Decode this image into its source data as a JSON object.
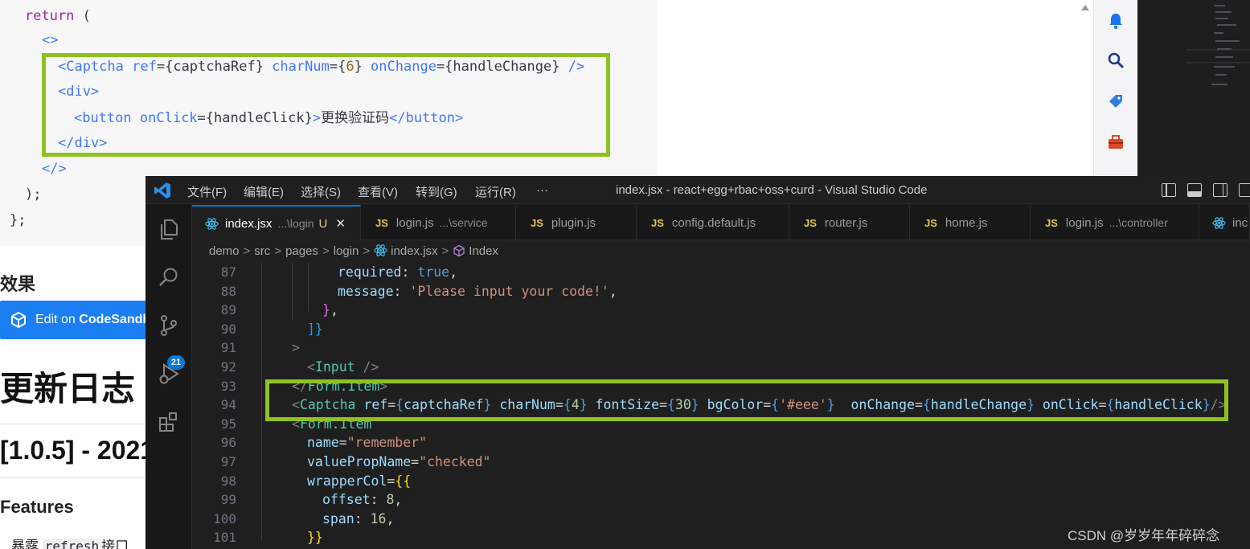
{
  "doc": {
    "code_lines": [
      {
        "tokens": [
          {
            "t": "return",
            "c": "kw"
          },
          {
            "t": " (",
            "c": "br"
          }
        ]
      },
      {
        "tokens": [
          {
            "t": "<>",
            "c": "tag"
          }
        ]
      },
      {
        "tokens": [
          {
            "t": "<Captcha",
            "c": "tag"
          },
          {
            "t": " ref",
            "c": "attr"
          },
          {
            "t": "={",
            "c": "br"
          },
          {
            "t": "captchaRef",
            "c": "id"
          },
          {
            "t": "}",
            "c": "br"
          },
          {
            "t": " charNum",
            "c": "attr"
          },
          {
            "t": "={",
            "c": "br"
          },
          {
            "t": "6",
            "c": "num"
          },
          {
            "t": "}",
            "c": "br"
          },
          {
            "t": " onChange",
            "c": "attr"
          },
          {
            "t": "={",
            "c": "br"
          },
          {
            "t": "handleChange",
            "c": "id"
          },
          {
            "t": "}",
            "c": "br"
          },
          {
            "t": " />",
            "c": "tag"
          }
        ]
      },
      {
        "tokens": [
          {
            "t": "<div>",
            "c": "tag"
          }
        ]
      },
      {
        "tokens": [
          {
            "t": "<button",
            "c": "tag"
          },
          {
            "t": " onClick",
            "c": "attr"
          },
          {
            "t": "={",
            "c": "br"
          },
          {
            "t": "handleClick",
            "c": "id"
          },
          {
            "t": "}",
            "c": "br"
          },
          {
            "t": ">",
            "c": "tag"
          },
          {
            "t": "更换验证码",
            "c": "cn"
          },
          {
            "t": "</button>",
            "c": "tag"
          }
        ]
      },
      {
        "tokens": [
          {
            "t": "</div>",
            "c": "tag"
          }
        ]
      },
      {
        "tokens": [
          {
            "t": "</>",
            "c": "tag"
          }
        ]
      },
      {
        "tokens": [
          {
            "t": ");",
            "c": "br"
          }
        ]
      },
      {
        "tokens": [
          {
            "t": "};",
            "c": "br"
          }
        ]
      }
    ],
    "effect_heading": "效果",
    "codesandbox_label_prefix": "Edit on ",
    "codesandbox_label_bold": "CodeSandb",
    "changelog_heading": "更新日志",
    "version_heading": "[1.0.5] - 2021",
    "features_heading": "Features",
    "list_item_prefix": "暴露",
    "list_item_code": "refresh",
    "list_item_suffix": "接口"
  },
  "vscode": {
    "menu": [
      "文件(F)",
      "编辑(E)",
      "选择(S)",
      "查看(V)",
      "转到(G)",
      "运行(R)",
      "···"
    ],
    "window_title": "index.jsx - react+egg+rbac+oss+curd - Visual Studio Code",
    "scm_badge": "21",
    "tabs": [
      {
        "name": "index.jsx",
        "desc": "...\\login",
        "badge": "U",
        "kind": "react",
        "active": true
      },
      {
        "name": "login.js",
        "desc": "...\\service",
        "kind": "js"
      },
      {
        "name": "plugin.js",
        "desc": "",
        "kind": "js"
      },
      {
        "name": "config.default.js",
        "desc": "",
        "kind": "js"
      },
      {
        "name": "router.js",
        "desc": "",
        "kind": "js"
      },
      {
        "name": "home.js",
        "desc": "",
        "kind": "js"
      },
      {
        "name": "login.js",
        "desc": "...\\controller",
        "kind": "js"
      },
      {
        "name": "inc",
        "desc": "",
        "kind": "react"
      }
    ],
    "breadcrumb": [
      "demo",
      "src",
      "pages",
      "login",
      "index.jsx",
      "Index"
    ],
    "line_numbers": [
      "87",
      "88",
      "89",
      "90",
      "91",
      "92",
      "93",
      "94",
      "95",
      "96",
      "97",
      "98",
      "99",
      "100",
      "101"
    ],
    "code_lines": [
      [
        {
          "t": "required",
          "c": "prop"
        },
        {
          "t": ": ",
          "c": "plain"
        },
        {
          "t": "true",
          "c": "kw"
        },
        {
          "t": ",",
          "c": "plain"
        }
      ],
      [
        {
          "t": "message",
          "c": "prop"
        },
        {
          "t": ": ",
          "c": "plain"
        },
        {
          "t": "'Please input your code!'",
          "c": "str"
        },
        {
          "t": ",",
          "c": "plain"
        }
      ],
      [
        {
          "t": "}",
          "c": "br2"
        },
        {
          "t": ",",
          "c": "plain"
        }
      ],
      [
        {
          "t": "]}",
          "c": "br3"
        }
      ],
      [
        {
          "t": ">",
          "c": "ang"
        }
      ],
      [
        {
          "t": "<",
          "c": "ang"
        },
        {
          "t": "Input",
          "c": "tag"
        },
        {
          "t": " />",
          "c": "ang"
        }
      ],
      [
        {
          "t": "</",
          "c": "ang"
        },
        {
          "t": "Form.Item",
          "c": "tag"
        },
        {
          "t": ">",
          "c": "ang"
        }
      ],
      [
        {
          "t": "<",
          "c": "ang"
        },
        {
          "t": "Captcha",
          "c": "tag"
        },
        {
          "t": " ref",
          "c": "prop"
        },
        {
          "t": "=",
          "c": "plain"
        },
        {
          "t": "{",
          "c": "kw"
        },
        {
          "t": "captchaRef",
          "c": "prop"
        },
        {
          "t": "}",
          "c": "kw"
        },
        {
          "t": " charNum",
          "c": "prop"
        },
        {
          "t": "=",
          "c": "plain"
        },
        {
          "t": "{",
          "c": "kw"
        },
        {
          "t": "4",
          "c": "num"
        },
        {
          "t": "}",
          "c": "kw"
        },
        {
          "t": " fontSize",
          "c": "prop"
        },
        {
          "t": "=",
          "c": "plain"
        },
        {
          "t": "{",
          "c": "kw"
        },
        {
          "t": "30",
          "c": "num"
        },
        {
          "t": "}",
          "c": "kw"
        },
        {
          "t": " bgColor",
          "c": "prop"
        },
        {
          "t": "=",
          "c": "plain"
        },
        {
          "t": "{",
          "c": "kw"
        },
        {
          "t": "'#eee'",
          "c": "str"
        },
        {
          "t": "}",
          "c": "kw"
        },
        {
          "t": "  onChange",
          "c": "prop"
        },
        {
          "t": "=",
          "c": "plain"
        },
        {
          "t": "{",
          "c": "kw"
        },
        {
          "t": "handleChange",
          "c": "prop"
        },
        {
          "t": "}",
          "c": "kw"
        },
        {
          "t": " onClick",
          "c": "prop"
        },
        {
          "t": "=",
          "c": "plain"
        },
        {
          "t": "{",
          "c": "kw"
        },
        {
          "t": "handleClick",
          "c": "prop"
        },
        {
          "t": "}",
          "c": "kw"
        },
        {
          "t": "/>",
          "c": "ang"
        }
      ],
      [
        {
          "t": "<",
          "c": "ang"
        },
        {
          "t": "Form.Item",
          "c": "tag"
        }
      ],
      [
        {
          "t": "name",
          "c": "prop"
        },
        {
          "t": "=",
          "c": "plain"
        },
        {
          "t": "\"remember\"",
          "c": "str"
        }
      ],
      [
        {
          "t": "valuePropName",
          "c": "prop"
        },
        {
          "t": "=",
          "c": "plain"
        },
        {
          "t": "\"checked\"",
          "c": "str"
        }
      ],
      [
        {
          "t": "wrapperCol",
          "c": "prop"
        },
        {
          "t": "=",
          "c": "plain"
        },
        {
          "t": "{{",
          "c": "br1"
        }
      ],
      [
        {
          "t": "offset",
          "c": "prop"
        },
        {
          "t": ": ",
          "c": "plain"
        },
        {
          "t": "8",
          "c": "num"
        },
        {
          "t": ",",
          "c": "plain"
        }
      ],
      [
        {
          "t": "span",
          "c": "prop"
        },
        {
          "t": ": ",
          "c": "plain"
        },
        {
          "t": "16",
          "c": "num"
        },
        {
          "t": ",",
          "c": "plain"
        }
      ],
      [
        {
          "t": "}}",
          "c": "br1"
        }
      ]
    ],
    "watermark": "CSDN @岁岁年年碎碎念"
  },
  "colors": {
    "highlight_box": "#8dc21f",
    "vscode_accent": "#0078d4",
    "codesandbox_blue": "#1b7ef2"
  }
}
